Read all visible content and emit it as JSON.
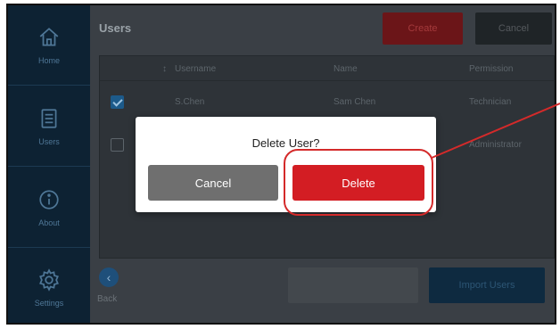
{
  "sidebar": {
    "items": [
      {
        "label": "Home",
        "icon": "home-icon"
      },
      {
        "label": "Users",
        "icon": "users-list-icon"
      },
      {
        "label": "About",
        "icon": "info-icon"
      },
      {
        "label": "Settings",
        "icon": "gear-icon"
      }
    ]
  },
  "header": {
    "title": "Users",
    "create_label": "Create",
    "cancel_label": "Cancel"
  },
  "table": {
    "columns": [
      "Username",
      "Name",
      "Permission"
    ],
    "rows": [
      {
        "checked": true,
        "username": "S.Chen",
        "name": "Sam Chen",
        "permission": "Technician"
      },
      {
        "checked": false,
        "username": "",
        "name": "",
        "permission": "Administrator"
      }
    ]
  },
  "footer": {
    "back_label": "Back",
    "import_label": "Import Users"
  },
  "modal": {
    "title": "Delete User?",
    "cancel_label": "Cancel",
    "delete_label": "Delete"
  },
  "colors": {
    "sidebar_bg": "#0d2233",
    "delete_red": "#d31d23",
    "cancel_gray": "#6f6f6f",
    "annotation_red": "#d42a2a"
  }
}
